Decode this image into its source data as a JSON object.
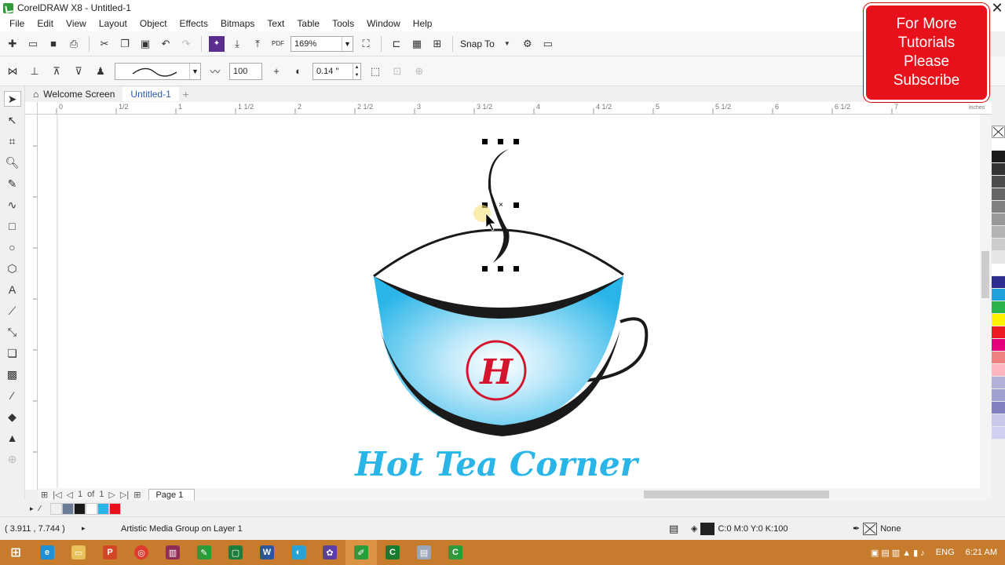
{
  "window": {
    "title": "CorelDRAW X8 - Untitled-1"
  },
  "menu": [
    "File",
    "Edit",
    "View",
    "Layout",
    "Object",
    "Effects",
    "Bitmaps",
    "Text",
    "Table",
    "Tools",
    "Window",
    "Help"
  ],
  "toolbar": {
    "zoom": "169%",
    "snap": "Snap To"
  },
  "property_bar": {
    "smoothing": "100",
    "width": "0.14 \""
  },
  "tabs": [
    "Welcome Screen",
    "Untitled-1"
  ],
  "ruler": {
    "marks": [
      "0",
      "1/2",
      "1",
      "1 1/2",
      "2",
      "2 1/2",
      "3",
      "3 1/2",
      "4",
      "4 1/2",
      "5",
      "5 1/2",
      "6",
      "6 1/2",
      "7"
    ],
    "unit": "inches"
  },
  "page_nav": {
    "current": "1",
    "of": "of",
    "total": "1",
    "page_tab": "Page 1"
  },
  "artwork": {
    "cup_color": "#29b5e8",
    "monogram": "H",
    "brand": "Hot Tea Corner"
  },
  "status": {
    "coords": "( 3.911 , 7.744 )",
    "selection": "Artistic Media Group on Layer 1",
    "fill": "C:0 M:0 Y:0 K:100",
    "outline": "None"
  },
  "promo": {
    "text": "For More\nTutorials\nPlease\nSubscribe"
  },
  "tray": {
    "lang": "ENG",
    "time": "6:21 AM"
  },
  "palette": [
    "#ffffff",
    "#1a1a1a",
    "#333333",
    "#4d4d4d",
    "#666666",
    "#808080",
    "#999999",
    "#b3b3b3",
    "#cccccc",
    "#e6e6e6",
    "#ffffff",
    "#2d2d8f",
    "#1fa3db",
    "#2ab34a",
    "#fff200",
    "#ed1c24",
    "#e6007e",
    "#f08080",
    "#ffb6c1",
    "#b0b0d8",
    "#a0a0d0",
    "#8080c0",
    "#c8c8e8",
    "#d0d0f0"
  ],
  "doc_palette": [
    "#6c7b95",
    "#1a1a1a",
    "#ffffff",
    "#29b5e8",
    "#e8101a"
  ]
}
